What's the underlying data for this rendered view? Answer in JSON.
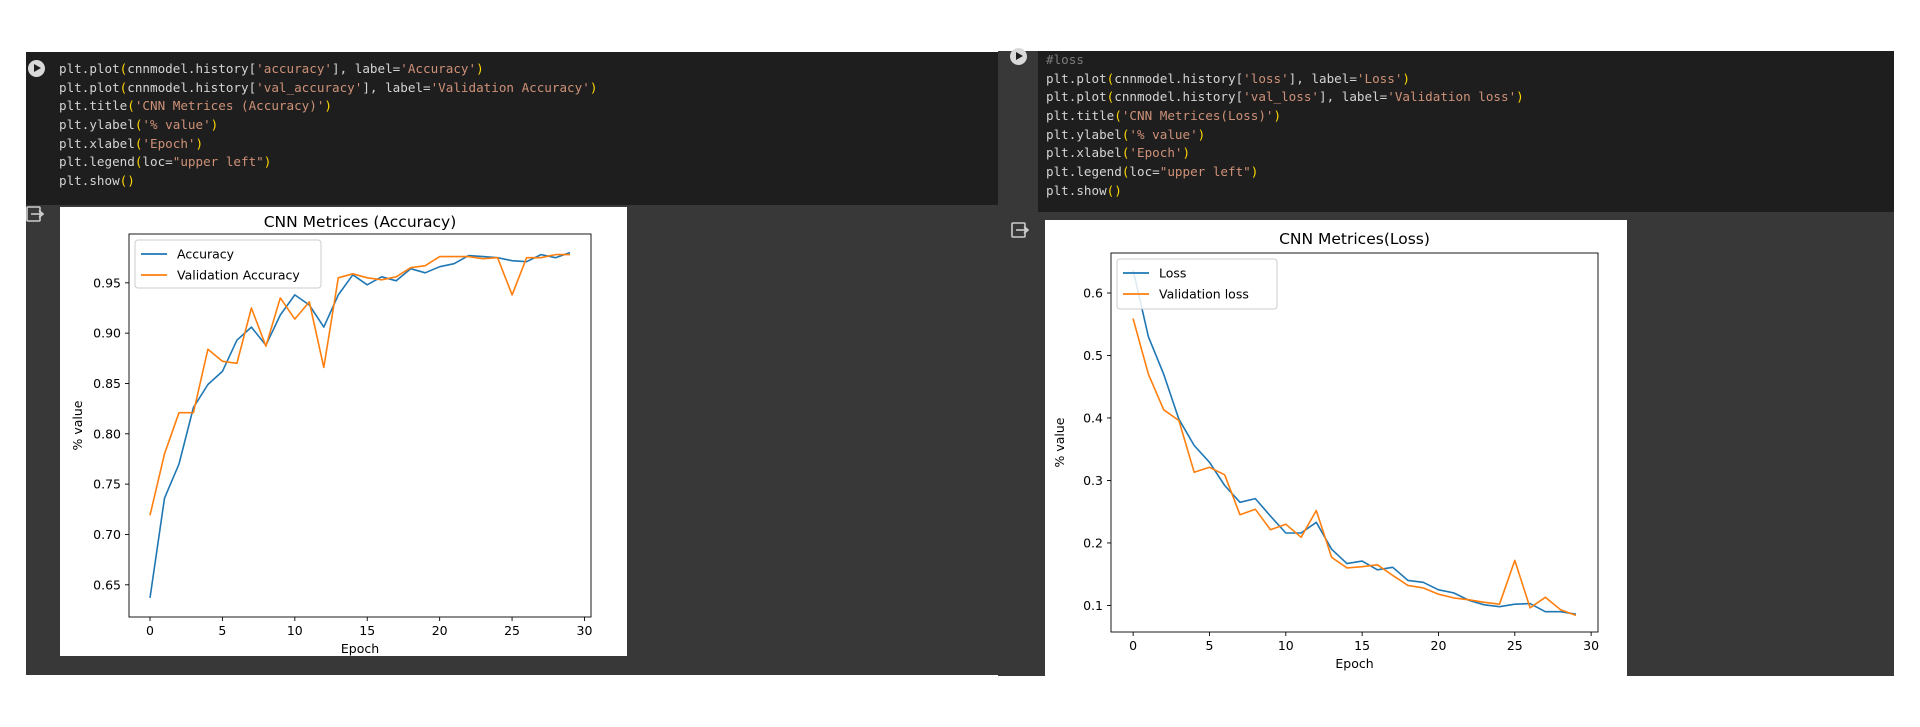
{
  "left_cell": {
    "code_lines": [
      [
        {
          "t": "plt.plot",
          "c": "fn"
        },
        {
          "t": "(",
          "c": "paren"
        },
        {
          "t": "cnnmodel.history[",
          "c": "fn"
        },
        {
          "t": "'accuracy'",
          "c": "str"
        },
        {
          "t": "], label=",
          "c": "fn"
        },
        {
          "t": "'Accuracy'",
          "c": "str"
        },
        {
          "t": ")",
          "c": "paren"
        }
      ],
      [
        {
          "t": "plt.plot",
          "c": "fn"
        },
        {
          "t": "(",
          "c": "paren"
        },
        {
          "t": "cnnmodel.history[",
          "c": "fn"
        },
        {
          "t": "'val_accuracy'",
          "c": "str"
        },
        {
          "t": "], label=",
          "c": "fn"
        },
        {
          "t": "'Validation Accuracy'",
          "c": "str"
        },
        {
          "t": ")",
          "c": "paren"
        }
      ],
      [
        {
          "t": "plt.title",
          "c": "fn"
        },
        {
          "t": "(",
          "c": "paren"
        },
        {
          "t": "'CNN Metrices (Accuracy)'",
          "c": "str"
        },
        {
          "t": ")",
          "c": "paren"
        }
      ],
      [
        {
          "t": "plt.ylabel",
          "c": "fn"
        },
        {
          "t": "(",
          "c": "paren"
        },
        {
          "t": "'% value'",
          "c": "str"
        },
        {
          "t": ")",
          "c": "paren"
        }
      ],
      [
        {
          "t": "plt.xlabel",
          "c": "fn"
        },
        {
          "t": "(",
          "c": "paren"
        },
        {
          "t": "'Epoch'",
          "c": "str"
        },
        {
          "t": ")",
          "c": "paren"
        }
      ],
      [
        {
          "t": "plt.legend",
          "c": "fn"
        },
        {
          "t": "(",
          "c": "paren"
        },
        {
          "t": "loc=",
          "c": "fn"
        },
        {
          "t": "\"upper left\"",
          "c": "str"
        },
        {
          "t": ")",
          "c": "paren"
        }
      ],
      [
        {
          "t": "plt.show",
          "c": "fn"
        },
        {
          "t": "()",
          "c": "paren"
        }
      ]
    ]
  },
  "right_cell": {
    "code_lines": [
      [
        {
          "t": "#loss",
          "c": "cm"
        }
      ],
      [
        {
          "t": "plt.plot",
          "c": "fn"
        },
        {
          "t": "(",
          "c": "paren"
        },
        {
          "t": "cnnmodel.history[",
          "c": "fn"
        },
        {
          "t": "'loss'",
          "c": "str"
        },
        {
          "t": "], label=",
          "c": "fn"
        },
        {
          "t": "'Loss'",
          "c": "str"
        },
        {
          "t": ")",
          "c": "paren"
        }
      ],
      [
        {
          "t": "plt.plot",
          "c": "fn"
        },
        {
          "t": "(",
          "c": "paren"
        },
        {
          "t": "cnnmodel.history[",
          "c": "fn"
        },
        {
          "t": "'val_loss'",
          "c": "str"
        },
        {
          "t": "], label=",
          "c": "fn"
        },
        {
          "t": "'Validation loss'",
          "c": "str"
        },
        {
          "t": ")",
          "c": "paren"
        }
      ],
      [
        {
          "t": "plt.title",
          "c": "fn"
        },
        {
          "t": "(",
          "c": "paren"
        },
        {
          "t": "'CNN Metrices(Loss)'",
          "c": "str"
        },
        {
          "t": ")",
          "c": "paren"
        }
      ],
      [
        {
          "t": "plt.ylabel",
          "c": "fn"
        },
        {
          "t": "(",
          "c": "paren"
        },
        {
          "t": "'% value'",
          "c": "str"
        },
        {
          "t": ")",
          "c": "paren"
        }
      ],
      [
        {
          "t": "plt.xlabel",
          "c": "fn"
        },
        {
          "t": "(",
          "c": "paren"
        },
        {
          "t": "'Epoch'",
          "c": "str"
        },
        {
          "t": ")",
          "c": "paren"
        }
      ],
      [
        {
          "t": "plt.legend",
          "c": "fn"
        },
        {
          "t": "(",
          "c": "paren"
        },
        {
          "t": "loc=",
          "c": "fn"
        },
        {
          "t": "\"upper left\"",
          "c": "str"
        },
        {
          "t": ")",
          "c": "paren"
        }
      ],
      [
        {
          "t": "plt.show",
          "c": "fn"
        },
        {
          "t": "()",
          "c": "paren"
        }
      ]
    ]
  },
  "icons": {
    "run": "play-icon",
    "output": "output-icon"
  },
  "colors": {
    "series_blue": "#1f77b4",
    "series_orange": "#ff7f0e",
    "code_bg": "#1e1e1e",
    "output_bg": "#383838"
  },
  "chart_data": [
    {
      "type": "line",
      "title": "CNN Metrices (Accuracy)",
      "xlabel": "Epoch",
      "ylabel": "% value",
      "xlim": [
        -1.45,
        30.45
      ],
      "ylim": [
        0.618,
        0.9985
      ],
      "xticks": [
        0,
        5,
        10,
        15,
        20,
        25,
        30
      ],
      "yticks": [
        0.65,
        0.7,
        0.75,
        0.8,
        0.85,
        0.9,
        0.95
      ],
      "legend_position": "upper left",
      "grid": false,
      "x": [
        0,
        1,
        2,
        3,
        4,
        5,
        6,
        7,
        8,
        9,
        10,
        11,
        12,
        13,
        14,
        15,
        16,
        17,
        18,
        19,
        20,
        21,
        22,
        23,
        24,
        25,
        26,
        27,
        28,
        29
      ],
      "series": [
        {
          "name": "Accuracy",
          "color": "#1f77b4",
          "values": [
            0.637,
            0.736,
            0.77,
            0.826,
            0.849,
            0.862,
            0.893,
            0.906,
            0.888,
            0.918,
            0.938,
            0.928,
            0.906,
            0.938,
            0.958,
            0.948,
            0.956,
            0.952,
            0.964,
            0.96,
            0.966,
            0.969,
            0.977,
            0.976,
            0.975,
            0.972,
            0.971,
            0.978,
            0.975,
            0.98
          ]
        },
        {
          "name": "Validation Accuracy",
          "color": "#ff7f0e",
          "values": [
            0.719,
            0.78,
            0.821,
            0.821,
            0.884,
            0.872,
            0.87,
            0.925,
            0.887,
            0.935,
            0.914,
            0.931,
            0.866,
            0.955,
            0.959,
            0.955,
            0.953,
            0.956,
            0.965,
            0.967,
            0.976,
            0.976,
            0.976,
            0.974,
            0.975,
            0.938,
            0.975,
            0.975,
            0.978,
            0.978
          ]
        }
      ]
    },
    {
      "type": "line",
      "title": "CNN Metrices(Loss)",
      "xlabel": "Epoch",
      "ylabel": "% value",
      "xlim": [
        -1.45,
        30.45
      ],
      "ylim": [
        0.0575,
        0.664
      ],
      "xticks": [
        0,
        5,
        10,
        15,
        20,
        25,
        30
      ],
      "yticks": [
        0.1,
        0.2,
        0.3,
        0.4,
        0.5,
        0.6
      ],
      "legend_position": "upper left",
      "grid": false,
      "x": [
        0,
        1,
        2,
        3,
        4,
        5,
        6,
        7,
        8,
        9,
        10,
        11,
        12,
        13,
        14,
        15,
        16,
        17,
        18,
        19,
        20,
        21,
        22,
        23,
        24,
        25,
        26,
        27,
        28,
        29
      ],
      "series": [
        {
          "name": "Loss",
          "color": "#1f77b4",
          "values": [
            0.637,
            0.53,
            0.47,
            0.398,
            0.356,
            0.329,
            0.292,
            0.265,
            0.271,
            0.243,
            0.216,
            0.216,
            0.233,
            0.19,
            0.167,
            0.171,
            0.157,
            0.161,
            0.14,
            0.137,
            0.125,
            0.12,
            0.108,
            0.101,
            0.098,
            0.102,
            0.103,
            0.09,
            0.09,
            0.086
          ]
        },
        {
          "name": "Validation loss",
          "color": "#ff7f0e",
          "values": [
            0.559,
            0.47,
            0.413,
            0.396,
            0.313,
            0.321,
            0.309,
            0.245,
            0.254,
            0.221,
            0.23,
            0.209,
            0.252,
            0.177,
            0.16,
            0.162,
            0.165,
            0.148,
            0.132,
            0.128,
            0.118,
            0.112,
            0.109,
            0.105,
            0.102,
            0.172,
            0.096,
            0.113,
            0.093,
            0.084
          ]
        }
      ]
    }
  ]
}
